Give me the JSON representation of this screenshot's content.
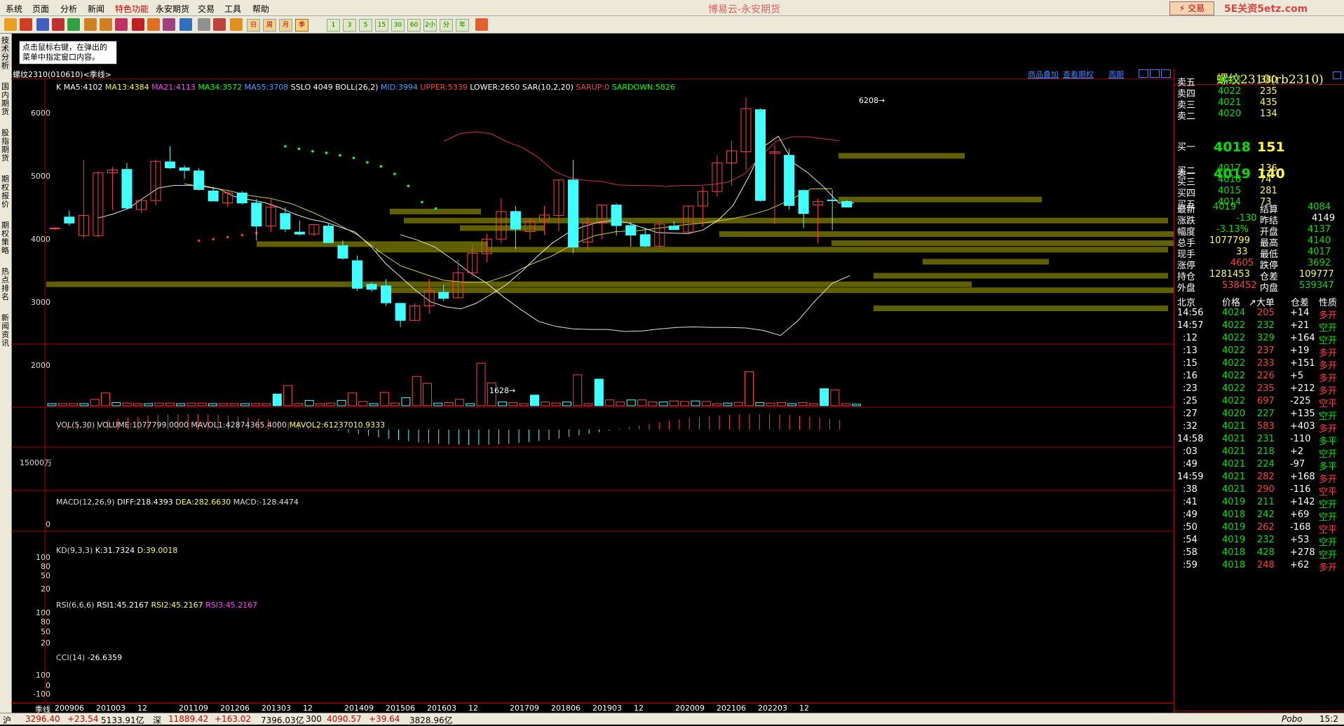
{
  "menu": {
    "items": [
      "系统",
      "页面",
      "分析",
      "新闻",
      "特色功能",
      "永安期货",
      "交易",
      "工具",
      "帮助"
    ],
    "title": "博易云-永安期货",
    "trade_button": "⚡ 交易",
    "watermark": "5E关资5etz.com"
  },
  "toolbar": {
    "period_buttons": [
      "日",
      "周",
      "月",
      "季",
      "1",
      "3",
      "5",
      "15",
      "30",
      "60",
      "2小",
      "分",
      "年"
    ]
  },
  "left_tabs": [
    "技术分析",
    "国内期货",
    "股指期货",
    "期权报价",
    "期权策略",
    "热点排名",
    "新闻资讯"
  ],
  "hint": "点击鼠标右键，在弹出的菜单中指定窗口内容。",
  "chart_header": {
    "symbol": "螺纹2310(010610)<季线>",
    "links": [
      "商品叠加",
      "查看期权",
      "周期"
    ]
  },
  "main_indicator": {
    "k": "K",
    "items": [
      {
        "text": "MA5:4102",
        "color": "#ffffff"
      },
      {
        "text": "MA13:4384",
        "color": "#ffff00"
      },
      {
        "text": "MA21:4113",
        "color": "#ff40ff"
      },
      {
        "text": "MA34:3572",
        "color": "#00ff00"
      },
      {
        "text": "MA55:3708",
        "color": "#40a0ff"
      },
      {
        "text": "SSLO 4049",
        "color": "#ffffff"
      },
      {
        "text": "BOLL(26,2)",
        "color": "#ffffff"
      },
      {
        "text": "MID:3994",
        "color": "#40a0ff"
      },
      {
        "text": "UPPER:5339",
        "color": "#ff4040"
      },
      {
        "text": "LOWER:2650",
        "color": "#ffffff"
      },
      {
        "text": "SAR(10,2,20)",
        "color": "#ffffff"
      },
      {
        "text": "SARUP:0",
        "color": "#ff4040"
      },
      {
        "text": "SARDOWN:5826",
        "color": "#00ff00"
      }
    ],
    "y_ticks": [
      "6000",
      "5000",
      "4000",
      "3000",
      "2000"
    ],
    "high_label": "6208",
    "low_label": "1628"
  },
  "vol_panel": {
    "title": "VOL(5,30) VOLUME:1077799.0000 MAVOL1:42874365.4000",
    "mavol2": "MAVOL2:61237010.9333",
    "y_tick": "15000万"
  },
  "macd_panel": {
    "title": "MACD(12,26,9)",
    "diff": "DIFF:218.4393",
    "dea": "DEA:282.6630",
    "macd": "MACD:-128.4474",
    "y_tick": "0"
  },
  "kd_panel": {
    "title": "KD(9,3,3)",
    "k": "K:31.7324",
    "d": "D:39.0018",
    "y_ticks": [
      "100",
      "80",
      "50",
      "20"
    ]
  },
  "rsi_panel": {
    "title": "RSI(6,6,6)",
    "rsi1": "RSI1:45.2167",
    "rsi2": "RSI2:45.2167",
    "rsi3": "RSI3:45.2167",
    "y_ticks": [
      "100",
      "80",
      "50",
      "20"
    ]
  },
  "cci_panel": {
    "title": "CCI(14)",
    "value": "-26.6359",
    "y_ticks": [
      "100",
      "0",
      "-100"
    ]
  },
  "x_axis": {
    "period": "季线",
    "labels": [
      "200906",
      "201003",
      "12",
      "201109",
      "201206",
      "201303",
      "12",
      "201409",
      "201506",
      "201603",
      "12",
      "201709",
      "201806",
      "201903",
      "12",
      "202009",
      "202106",
      "202203",
      "12"
    ]
  },
  "chart_data": {
    "type": "candlestick",
    "title": "螺纹2310(010610)<季线>",
    "ylim": [
      1400,
      6400
    ],
    "candles": [
      {
        "o": 3600,
        "h": 3620,
        "l": 3560,
        "c": 3600
      },
      {
        "o": 3820,
        "h": 3950,
        "l": 3650,
        "c": 3700
      },
      {
        "o": 3450,
        "h": 4960,
        "l": 3400,
        "c": 3850
      },
      {
        "o": 3450,
        "h": 4730,
        "l": 3420,
        "c": 4700
      },
      {
        "o": 4700,
        "h": 4820,
        "l": 3960,
        "c": 4760
      },
      {
        "o": 4770,
        "h": 4900,
        "l": 3980,
        "c": 4000
      },
      {
        "o": 3970,
        "h": 4160,
        "l": 3900,
        "c": 4150
      },
      {
        "o": 4150,
        "h": 4960,
        "l": 4050,
        "c": 4930
      },
      {
        "o": 4920,
        "h": 5230,
        "l": 4780,
        "c": 4800
      },
      {
        "o": 4800,
        "h": 4850,
        "l": 4580,
        "c": 4750
      },
      {
        "o": 4740,
        "h": 4800,
        "l": 4350,
        "c": 4370
      },
      {
        "o": 4340,
        "h": 4420,
        "l": 4140,
        "c": 4140
      },
      {
        "o": 4100,
        "h": 4340,
        "l": 4020,
        "c": 4300
      },
      {
        "o": 4300,
        "h": 4340,
        "l": 4070,
        "c": 4100
      },
      {
        "o": 4100,
        "h": 4180,
        "l": 3350,
        "c": 3640
      },
      {
        "o": 3640,
        "h": 4200,
        "l": 3520,
        "c": 4020
      },
      {
        "o": 3890,
        "h": 4010,
        "l": 3520,
        "c": 3580
      },
      {
        "o": 3520,
        "h": 3750,
        "l": 3450,
        "c": 3480
      },
      {
        "o": 3480,
        "h": 3670,
        "l": 3440,
        "c": 3670
      },
      {
        "o": 3640,
        "h": 3700,
        "l": 3300,
        "c": 3310
      },
      {
        "o": 3250,
        "h": 3350,
        "l": 2970,
        "c": 3000
      },
      {
        "o": 2950,
        "h": 3050,
        "l": 2350,
        "c": 2400
      },
      {
        "o": 2480,
        "h": 2520,
        "l": 2330,
        "c": 2380
      },
      {
        "o": 2450,
        "h": 2580,
        "l": 2050,
        "c": 2110
      },
      {
        "o": 2100,
        "h": 2100,
        "l": 1628,
        "c": 1760
      },
      {
        "o": 1760,
        "h": 2100,
        "l": 1740,
        "c": 2050
      },
      {
        "o": 2050,
        "h": 2590,
        "l": 1900,
        "c": 2350
      },
      {
        "o": 2320,
        "h": 2470,
        "l": 2150,
        "c": 2200
      },
      {
        "o": 2210,
        "h": 2970,
        "l": 2200,
        "c": 2710
      },
      {
        "o": 2710,
        "h": 3270,
        "l": 2650,
        "c": 3100
      },
      {
        "o": 3090,
        "h": 3490,
        "l": 2920,
        "c": 3380
      },
      {
        "o": 3380,
        "h": 4190,
        "l": 3300,
        "c": 3930
      },
      {
        "o": 3930,
        "h": 4040,
        "l": 3180,
        "c": 3580
      },
      {
        "o": 3530,
        "h": 3800,
        "l": 3370,
        "c": 3740
      },
      {
        "o": 3740,
        "h": 4040,
        "l": 3460,
        "c": 3860
      },
      {
        "o": 3850,
        "h": 4560,
        "l": 3540,
        "c": 4560
      },
      {
        "o": 4560,
        "h": 4960,
        "l": 3100,
        "c": 3220
      },
      {
        "o": 3320,
        "h": 3820,
        "l": 3170,
        "c": 3700
      },
      {
        "o": 3700,
        "h": 4060,
        "l": 3380,
        "c": 4060
      },
      {
        "o": 4060,
        "h": 4090,
        "l": 3450,
        "c": 3650
      },
      {
        "o": 3650,
        "h": 3730,
        "l": 3230,
        "c": 3460
      },
      {
        "o": 3470,
        "h": 3610,
        "l": 3220,
        "c": 3240
      },
      {
        "o": 3240,
        "h": 3740,
        "l": 3220,
        "c": 3680
      },
      {
        "o": 3640,
        "h": 3740,
        "l": 3560,
        "c": 3570
      },
      {
        "o": 3520,
        "h": 4050,
        "l": 3500,
        "c": 4040
      },
      {
        "o": 4040,
        "h": 4430,
        "l": 3630,
        "c": 4330
      },
      {
        "o": 4330,
        "h": 5050,
        "l": 4230,
        "c": 4900
      },
      {
        "o": 4900,
        "h": 5340,
        "l": 4450,
        "c": 5140
      },
      {
        "o": 5120,
        "h": 6208,
        "l": 4760,
        "c": 5980
      },
      {
        "o": 5960,
        "h": 5980,
        "l": 4130,
        "c": 4150
      },
      {
        "o": 5090,
        "h": 5260,
        "l": 3680,
        "c": 5120
      },
      {
        "o": 5050,
        "h": 5180,
        "l": 3970,
        "c": 4050
      },
      {
        "o": 4350,
        "h": 4370,
        "l": 3600,
        "c": 3890
      },
      {
        "o": 4060,
        "h": 4190,
        "l": 3290,
        "c": 4130
      },
      {
        "o": 4160,
        "h": 4360,
        "l": 3560,
        "c": 4150
      },
      {
        "o": 4130,
        "h": 4160,
        "l": 4010,
        "c": 4019
      }
    ],
    "volume_bars": [
      0.04,
      0.04,
      0.04,
      0.04,
      0.12,
      0.24,
      0.06,
      0.05,
      0.04,
      0.04,
      0.05,
      0.05,
      0.04,
      0.05,
      0.05,
      0.04,
      0.04,
      0.04,
      0.04,
      0.04,
      0.04,
      0.22,
      0.38,
      0.04,
      0.1,
      0.04,
      0.05,
      0.1,
      0.24,
      0.08,
      0.04,
      0.25,
      0.05,
      0.15,
      0.55,
      0.42,
      0.05,
      0.06,
      0.12,
      0.04,
      0.8,
      0.43,
      0.07,
      0.06,
      0.04,
      0.2,
      0.07,
      0.05,
      0.07,
      0.58,
      0.04,
      0.5,
      0.11,
      0.07,
      0.11,
      0.11,
      0.07,
      0.07,
      0.09,
      0.08,
      0.09,
      0.08,
      0.04,
      0.05,
      0.06,
      0.64,
      0.06,
      0.05,
      0.06,
      0.04,
      0.06,
      0.04,
      0.32,
      0.3,
      0.04,
      0.03
    ],
    "sar_up": [
      3350,
      3380,
      3420,
      3460,
      3500
    ],
    "sar_down": [
      5230,
      5180,
      5130,
      5100,
      5050,
      5000,
      4910,
      4830,
      4680,
      4440,
      4120,
      3990
    ],
    "ma5": [
      3800,
      3880,
      3990,
      4200,
      4400,
      4450,
      4450,
      4440,
      4380,
      4230,
      4170,
      4110,
      4010,
      3880,
      3780,
      3720,
      3620,
      3520,
      3250,
      2900,
      2630,
      2360,
      2130,
      2030,
      1990,
      2100,
      2280,
      2470,
      2730,
      3020,
      3290,
      3490,
      3620,
      3710,
      3750,
      3710,
      3610,
      3510,
      3500,
      3490,
      3560,
      3750,
      4050,
      4600,
      5220,
      5430,
      4900,
      4690,
      4420,
      4100,
      4102
    ],
    "ma13": [
      4480,
      4420,
      4350,
      4250,
      4190,
      4080,
      3900,
      3700,
      3470,
      3140,
      2850,
      2700,
      2560,
      2520,
      2520,
      2660,
      2870,
      3040,
      3280,
      3450,
      3530,
      3550,
      3600,
      3660,
      3700,
      3760,
      3840,
      3960,
      4150,
      4380,
      4384
    ],
    "boll_upper": [
      5330,
      5480,
      5520,
      5480,
      5320,
      5200,
      5000,
      4730,
      4600,
      4550,
      4530,
      4460,
      4450,
      4450,
      4430,
      4450,
      4450,
      4470,
      4520,
      4680,
      5020,
      5330,
      5420,
      5420,
      5380,
      5339
    ],
    "boll_lower": [
      3470,
      3360,
      3220,
      2980,
      2720,
      2500,
      2220,
      1970,
      1740,
      1640,
      1590,
      1580,
      1580,
      1540,
      1550,
      1590,
      1620,
      1630,
      1620,
      1620,
      1610,
      1560,
      1460,
      1750,
      2150,
      2500,
      2650
    ]
  },
  "right_panel": {
    "title": "螺纹2310(rb2310)",
    "asks": [
      {
        "label": "卖五",
        "price": "4023",
        "vol": "380"
      },
      {
        "label": "卖四",
        "price": "4022",
        "vol": "235"
      },
      {
        "label": "卖三",
        "price": "4021",
        "vol": "435"
      },
      {
        "label": "卖二",
        "price": "4020",
        "vol": "134"
      },
      {
        "label": "卖一",
        "price": "4019",
        "vol": "140"
      }
    ],
    "bids": [
      {
        "label": "买一",
        "price": "4018",
        "vol": "151"
      },
      {
        "label": "买二",
        "price": "4017",
        "vol": "136"
      },
      {
        "label": "买三",
        "price": "4016",
        "vol": "74"
      },
      {
        "label": "买四",
        "price": "4015",
        "vol": "281"
      },
      {
        "label": "买五",
        "price": "4014",
        "vol": "73"
      }
    ],
    "stats": [
      {
        "l1": "最新",
        "v1": "4019",
        "c1": "grn",
        "l2": "结算",
        "v2": "4084",
        "c2": "grn"
      },
      {
        "l1": "涨跌",
        "v1": "-130",
        "c1": "grn",
        "l2": "昨结",
        "v2": "4149",
        "c2": "wht"
      },
      {
        "l1": "幅度",
        "v1": "-3.13%",
        "c1": "grn",
        "l2": "开盘",
        "v2": "4137",
        "c2": "grn"
      },
      {
        "l1": "总手",
        "v1": "1077799",
        "c1": "yel",
        "l2": "最高",
        "v2": "4140",
        "c2": "grn"
      },
      {
        "l1": "现手",
        "v1": "33",
        "c1": "yel",
        "l2": "最低",
        "v2": "4017",
        "c2": "grn"
      },
      {
        "l1": "涨停",
        "v1": "4605",
        "c1": "red",
        "l2": "跌停",
        "v2": "3692",
        "c2": "grn"
      },
      {
        "l1": "持仓",
        "v1": "1281453",
        "c1": "yel",
        "l2": "仓差",
        "v2": "109777",
        "c2": "yel"
      },
      {
        "l1": "外盘",
        "v1": "538452",
        "c1": "red",
        "l2": "内盘",
        "v2": "539347",
        "c2": "grn"
      }
    ],
    "tick_header": [
      "北京",
      "价格",
      "↗大单",
      "仓差",
      "性质"
    ],
    "ticks": [
      {
        "t": "14:56",
        "p": "4024",
        "pc": "grn",
        "v": "205",
        "vc": "red",
        "d": "+14",
        "n": "多开",
        "nc": "red"
      },
      {
        "t": "14:57",
        "p": "4022",
        "pc": "grn",
        "v": "232",
        "vc": "grn",
        "d": "+21",
        "n": "空开",
        "nc": "grn"
      },
      {
        "t": ":12",
        "p": "4022",
        "pc": "grn",
        "v": "329",
        "vc": "grn",
        "d": "+164",
        "n": "空开",
        "nc": "grn"
      },
      {
        "t": ":13",
        "p": "4022",
        "pc": "grn",
        "v": "237",
        "vc": "red",
        "d": "+19",
        "n": "多开",
        "nc": "red"
      },
      {
        "t": ":15",
        "p": "4022",
        "pc": "grn",
        "v": "233",
        "vc": "red",
        "d": "+151",
        "n": "多开",
        "nc": "red"
      },
      {
        "t": ":16",
        "p": "4022",
        "pc": "grn",
        "v": "226",
        "vc": "red",
        "d": "+5",
        "n": "多开",
        "nc": "red"
      },
      {
        "t": ":23",
        "p": "4022",
        "pc": "grn",
        "v": "235",
        "vc": "red",
        "d": "+212",
        "n": "多开",
        "nc": "red"
      },
      {
        "t": ":25",
        "p": "4022",
        "pc": "grn",
        "v": "697",
        "vc": "red",
        "d": "-225",
        "n": "空平",
        "nc": "red"
      },
      {
        "t": ":27",
        "p": "4020",
        "pc": "grn",
        "v": "227",
        "vc": "grn",
        "d": "+135",
        "n": "空开",
        "nc": "grn"
      },
      {
        "t": ":32",
        "p": "4021",
        "pc": "grn",
        "v": "583",
        "vc": "red",
        "d": "+403",
        "n": "多开",
        "nc": "red"
      },
      {
        "t": "14:58",
        "p": "4021",
        "pc": "grn",
        "v": "231",
        "vc": "grn",
        "d": "-110",
        "n": "多平",
        "nc": "grn"
      },
      {
        "t": ":03",
        "p": "4021",
        "pc": "grn",
        "v": "218",
        "vc": "grn",
        "d": "+2",
        "n": "空开",
        "nc": "grn"
      },
      {
        "t": ":49",
        "p": "4021",
        "pc": "grn",
        "v": "224",
        "vc": "grn",
        "d": "-97",
        "n": "多平",
        "nc": "grn"
      },
      {
        "t": "14:59",
        "p": "4021",
        "pc": "grn",
        "v": "282",
        "vc": "red",
        "d": "+168",
        "n": "多开",
        "nc": "red"
      },
      {
        "t": ":38",
        "p": "4021",
        "pc": "grn",
        "v": "290",
        "vc": "red",
        "d": "-116",
        "n": "空平",
        "nc": "red"
      },
      {
        "t": ":41",
        "p": "4019",
        "pc": "grn",
        "v": "211",
        "vc": "grn",
        "d": "+142",
        "n": "空开",
        "nc": "grn"
      },
      {
        "t": ":49",
        "p": "4018",
        "pc": "grn",
        "v": "242",
        "vc": "grn",
        "d": "+69",
        "n": "空开",
        "nc": "grn"
      },
      {
        "t": ":50",
        "p": "4019",
        "pc": "grn",
        "v": "262",
        "vc": "red",
        "d": "-168",
        "n": "空平",
        "nc": "red"
      },
      {
        "t": ":54",
        "p": "4019",
        "pc": "grn",
        "v": "232",
        "vc": "grn",
        "d": "+53",
        "n": "空开",
        "nc": "grn"
      },
      {
        "t": ":58",
        "p": "4018",
        "pc": "grn",
        "v": "428",
        "vc": "grn",
        "d": "+278",
        "n": "空开",
        "nc": "grn"
      },
      {
        "t": ":59",
        "p": "4018",
        "pc": "grn",
        "v": "248",
        "vc": "red",
        "d": "+62",
        "n": "多开",
        "nc": "red"
      }
    ],
    "bottom_tabs": [
      "笔",
      "权"
    ]
  },
  "status_bar": {
    "items": [
      {
        "text": "沪",
        "c": "#000"
      },
      {
        "text": "3296.40",
        "c": "#c00"
      },
      {
        "text": "+23.54",
        "c": "#c00"
      },
      {
        "text": "5133.91亿",
        "c": "#000"
      },
      {
        "text": "深",
        "c": "#000"
      },
      {
        "text": "11889.42",
        "c": "#c00"
      },
      {
        "text": "+163.02",
        "c": "#c00"
      },
      {
        "text": "7396.03亿",
        "c": "#000"
      },
      {
        "text": "300",
        "c": "#000"
      },
      {
        "text": "4090.57",
        "c": "#c00"
      },
      {
        "text": "+39.64",
        "c": "#c00"
      },
      {
        "text": "3828.96亿",
        "c": "#000"
      }
    ],
    "brand": "Pobo",
    "time": "15:2"
  }
}
